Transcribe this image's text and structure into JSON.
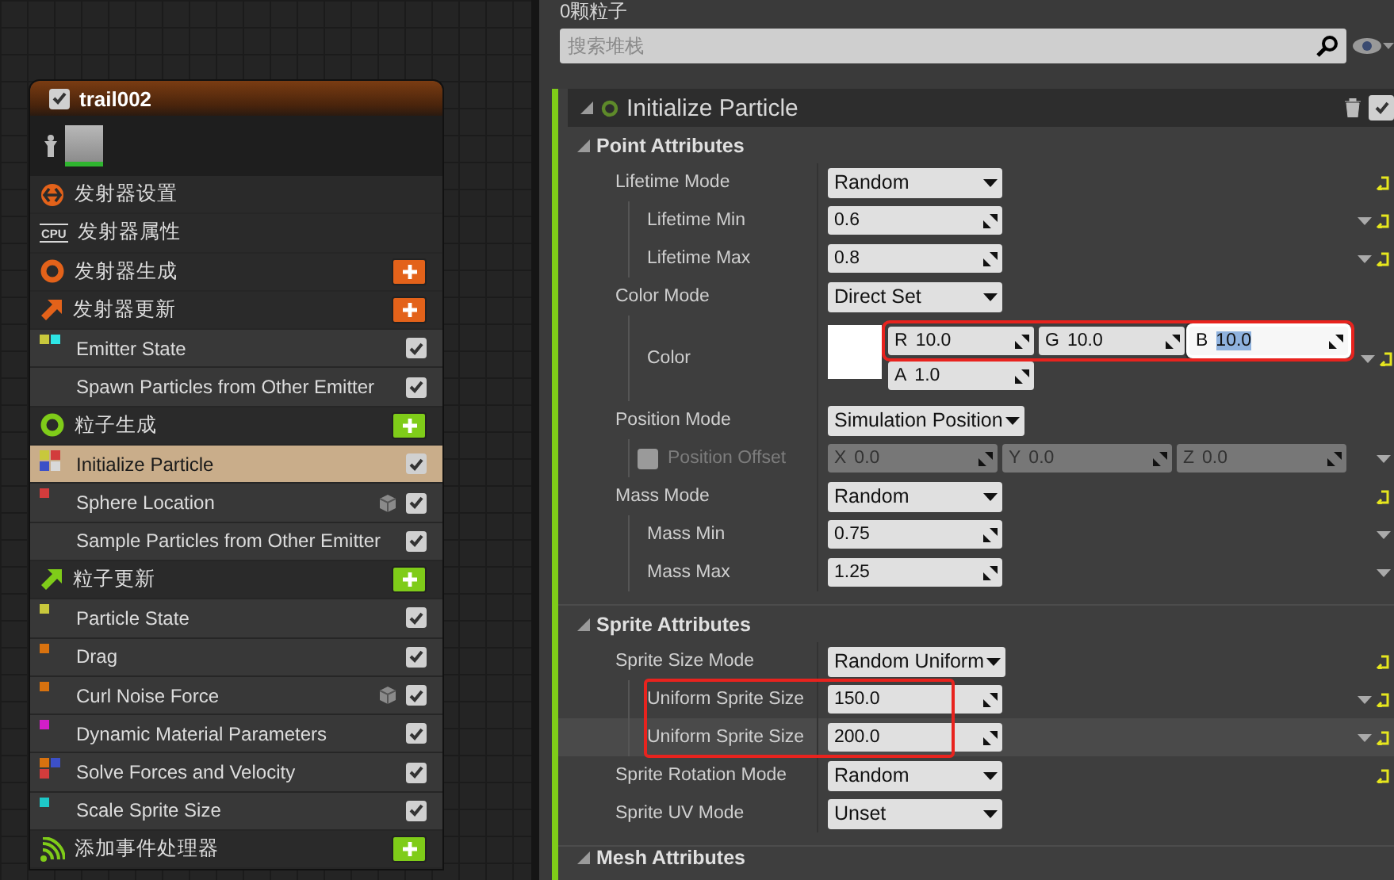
{
  "node": {
    "title": "trail002",
    "enabled": true,
    "items": [
      {
        "kind": "settings",
        "label": "发射器设置",
        "color": "#e3621a",
        "add": false
      },
      {
        "kind": "properties",
        "label": "发射器属性",
        "badge": "CPU",
        "add": false
      },
      {
        "kind": "spawn",
        "label": "发射器生成",
        "color": "#e3621a",
        "add": true
      },
      {
        "kind": "update",
        "label": "发射器更新",
        "color": "#e3621a",
        "add": true
      },
      {
        "kind": "module",
        "label": "Emitter State",
        "dots": [
          {
            "color": "#c8c83c"
          },
          {
            "color": "#2ee6e6"
          }
        ],
        "gpu": false,
        "checked": true,
        "selected": false
      },
      {
        "kind": "module",
        "label": "Spawn Particles from Other Emitter",
        "gpu": false,
        "checked": true,
        "selected": false
      },
      {
        "kind": "spawn",
        "label": "粒子生成",
        "color": "#7fcc19",
        "add": true
      },
      {
        "kind": "module",
        "label": "Initialize Particle",
        "dots": [
          {
            "color": "#c8c83c"
          },
          {
            "color": "#d23c3c"
          },
          {
            "color": "#3c50c8"
          },
          {
            "color": "#d8d8d8"
          }
        ],
        "gpu": false,
        "checked": true,
        "selected": true
      },
      {
        "kind": "module",
        "label": "Sphere Location",
        "dots": [
          {
            "color": "#d23c3c"
          }
        ],
        "gpu": true,
        "checked": true,
        "selected": false
      },
      {
        "kind": "module",
        "label": "Sample Particles from Other Emitter",
        "gpu": false,
        "checked": true,
        "selected": false
      },
      {
        "kind": "update",
        "label": "粒子更新",
        "color": "#7fcc19",
        "add": true
      },
      {
        "kind": "module",
        "label": "Particle State",
        "dots": [
          {
            "color": "#c8c83c"
          }
        ],
        "gpu": false,
        "checked": true,
        "selected": false
      },
      {
        "kind": "module",
        "label": "Drag",
        "dots": [
          {
            "color": "#d8720f"
          }
        ],
        "gpu": false,
        "checked": true,
        "selected": false
      },
      {
        "kind": "module",
        "label": "Curl Noise Force",
        "dots": [
          {
            "color": "#d8720f"
          }
        ],
        "gpu": true,
        "checked": true,
        "selected": false
      },
      {
        "kind": "module",
        "label": "Dynamic Material Parameters",
        "dots": [
          {
            "color": "#d21ec8"
          }
        ],
        "gpu": false,
        "checked": true,
        "selected": false
      },
      {
        "kind": "module",
        "label": "Solve Forces and Velocity",
        "dots": [
          {
            "color": "#d8720f"
          },
          {
            "color": "#3c50c8"
          },
          {
            "color": "#d23c3c"
          }
        ],
        "gpu": false,
        "checked": true,
        "selected": false
      },
      {
        "kind": "module",
        "label": "Scale Sprite Size",
        "dots": [
          {
            "color": "#1ec8c8"
          }
        ],
        "gpu": false,
        "checked": true,
        "selected": false
      },
      {
        "kind": "events",
        "label": "添加事件处理器",
        "color": "#7fcc19",
        "add": true
      }
    ]
  },
  "particle_count": "0颗粒子",
  "search": {
    "placeholder": "搜索堆栈"
  },
  "module": {
    "title": "Initialize Particle",
    "enabled": true,
    "sections": [
      {
        "title": "Point Attributes",
        "expanded": true,
        "rows": [
          {
            "kind": "dropdown",
            "label": "Lifetime Mode",
            "value": "Random",
            "menu": false,
            "reset": true,
            "children": [
              {
                "kind": "number",
                "label": "Lifetime Min",
                "value": "0.6",
                "menu": true,
                "reset": true
              },
              {
                "kind": "number",
                "label": "Lifetime Max",
                "value": "0.8",
                "menu": true,
                "reset": true
              }
            ]
          },
          {
            "kind": "dropdown",
            "label": "Color Mode",
            "value": "Direct Set",
            "menu": false,
            "reset": false,
            "children": [
              {
                "kind": "color",
                "label": "Color",
                "menu": true,
                "reset": true,
                "groups": [
                  {
                    "marked": true,
                    "fields": [
                      {
                        "axis": "R",
                        "value": "10.0",
                        "selected": false
                      },
                      {
                        "axis": "G",
                        "value": "10.0",
                        "selected": false
                      },
                      {
                        "axis": "B",
                        "value": "10.0",
                        "selected": true
                      }
                    ]
                  },
                  {
                    "marked": false,
                    "fields": [
                      {
                        "axis": "A",
                        "value": "1.0",
                        "selected": false
                      }
                    ]
                  }
                ]
              }
            ]
          },
          {
            "kind": "dropdown",
            "label": "Position Mode",
            "value": "Simulation Position",
            "menu": false,
            "reset": false,
            "children": [
              {
                "kind": "vector",
                "label": "Position Offset",
                "checked": false,
                "disabled": true,
                "menu": true,
                "reset": false,
                "fields": [
                  {
                    "axis": "X",
                    "value": "0.0"
                  },
                  {
                    "axis": "Y",
                    "value": "0.0"
                  },
                  {
                    "axis": "Z",
                    "value": "0.0"
                  }
                ]
              }
            ]
          },
          {
            "kind": "dropdown",
            "label": "Mass Mode",
            "value": "Random",
            "menu": false,
            "reset": true,
            "children": [
              {
                "kind": "number",
                "label": "Mass Min",
                "value": "0.75",
                "menu": true,
                "reset": false
              },
              {
                "kind": "number",
                "label": "Mass Max",
                "value": "1.25",
                "menu": true,
                "reset": false
              }
            ]
          }
        ]
      },
      {
        "title": "Sprite Attributes",
        "expanded": true,
        "rows": [
          {
            "kind": "dropdown",
            "label": "Sprite Size Mode",
            "value": "Random Uniform",
            "menu": false,
            "reset": true,
            "children": [
              {
                "kind": "group",
                "marked": true,
                "rows": [
                  {
                    "kind": "number",
                    "label": "Uniform Sprite Size",
                    "value": "150.0",
                    "menu": true,
                    "reset": true,
                    "highlighted": false
                  },
                  {
                    "kind": "number",
                    "label": "Uniform Sprite Size",
                    "value": "200.0",
                    "menu": true,
                    "reset": true,
                    "highlighted": true
                  }
                ]
              }
            ]
          },
          {
            "kind": "dropdown",
            "label": "Sprite Rotation Mode",
            "value": "Random",
            "menu": false,
            "reset": true
          },
          {
            "kind": "dropdown",
            "label": "Sprite UV Mode",
            "value": "Unset",
            "menu": false,
            "reset": false
          }
        ]
      },
      {
        "title": "Mesh Attributes",
        "expanded": true
      }
    ]
  }
}
